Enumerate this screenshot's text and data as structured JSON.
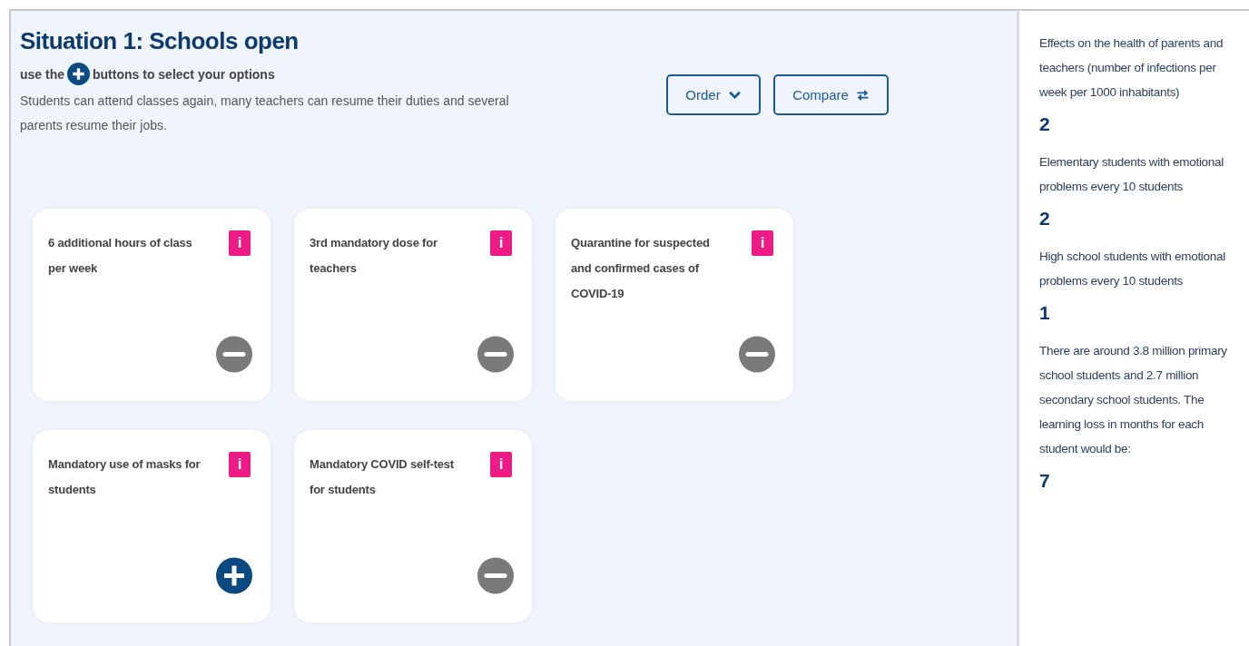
{
  "title": "Situation 1: Schools open",
  "instruction": {
    "before": "use the",
    "after": "buttons  to select your options"
  },
  "description": "Students can attend classes again, many teachers can resume their duties and several parents resume their jobs.",
  "buttons": [
    {
      "label": "Order",
      "kind": "dropdown"
    },
    {
      "label": "Compare",
      "kind": "compare"
    }
  ],
  "cards": [
    {
      "label": "6 additional hours of class per week",
      "info": "i",
      "selected": true
    },
    {
      "label": "3rd mandatory dose for teachers",
      "info": "i",
      "selected": true
    },
    {
      "label": "Quarantine for suspected and confirmed cases of COVID-19",
      "info": "i",
      "selected": true
    },
    {
      "label": "Mandatory use of masks for students",
      "info": "i",
      "selected": false
    },
    {
      "label": "Mandatory COVID self-test for students",
      "info": "i",
      "selected": true
    }
  ],
  "results": [
    {
      "label": "Effects on the health of parents and teachers (number of infections per week per 1000 inhabitants)",
      "value": "2"
    },
    {
      "label": "Elementary students with emotional problems every 10 students",
      "value": "2"
    },
    {
      "label": "High school students with emotional problems every 10 students",
      "value": "1"
    },
    {
      "label": "There are around 3.8 million primary school students and 2.7 million secondary school students. The learning loss in months for each student would be:",
      "value": "7"
    }
  ]
}
